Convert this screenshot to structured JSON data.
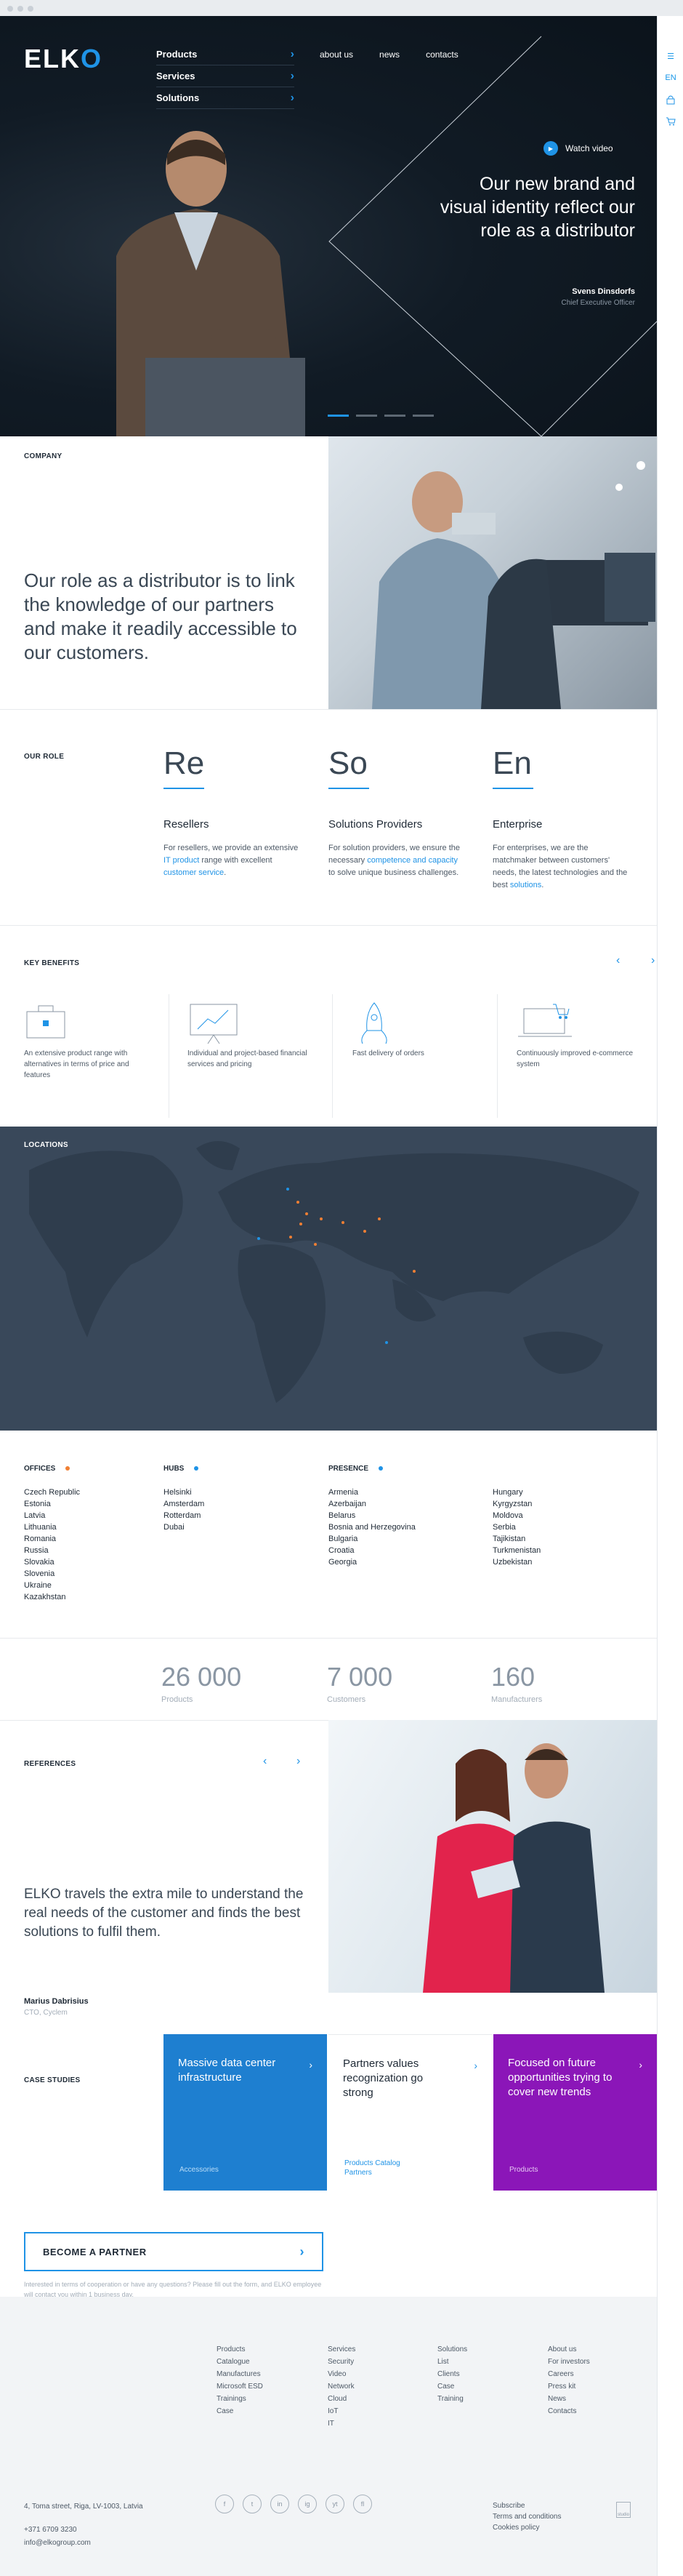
{
  "header": {
    "logo": {
      "prefix": "ELK",
      "accent": "O"
    },
    "product_menu": [
      "Products",
      "Services",
      "Solutions"
    ],
    "top_nav": [
      "about us",
      "news",
      "contacts"
    ]
  },
  "rail": {
    "menu_icon": "menu-icon",
    "lang": "EN",
    "lock_icon": "lock-icon",
    "cart_icon": "cart-icon"
  },
  "hero": {
    "watch_video": "Watch video",
    "title": "Our new brand and visual identity reflect our role as a distributor",
    "person": "Svens Dinsdorfs",
    "role": "Chief Executive Officer",
    "slides": 4,
    "active_slide": 0
  },
  "company": {
    "label": "COMPANY",
    "text": "Our role as a distributor is to link the knowledge of our partners and make it readily accessible to our customers."
  },
  "our_role": {
    "label": "OUR ROLE",
    "items": [
      {
        "abbr": "Re",
        "title": "Resellers",
        "text": [
          "For resellers, we provide an extensive ",
          "IT product",
          " range with excellent ",
          "customer service",
          "."
        ]
      },
      {
        "abbr": "So",
        "title": "Solutions Providers",
        "text": [
          "For solution providers, we ensure the necessary ",
          "competence and capacity",
          " to solve unique business challenges.",
          "",
          ""
        ]
      },
      {
        "abbr": "En",
        "title": "Enterprise",
        "text": [
          "For enterprises, we are the matchmaker between customers' needs, the latest technologies and the best ",
          "solutions",
          ".",
          "",
          ""
        ]
      }
    ]
  },
  "benefits": {
    "label": "KEY BENEFITS",
    "items": [
      "An extensive product range with alternatives in terms of price and features",
      "Individual and project-based financial services and pricing",
      "Fast delivery of orders",
      "Continuously improved e-commerce system"
    ]
  },
  "locations": {
    "label": "LOCATIONS",
    "colors": {
      "office": "#f07f33",
      "hub": "#1f93e6",
      "presence": "#1f93e6"
    }
  },
  "offices": {
    "label": "OFFICES",
    "items": [
      "Czech Republic",
      "Estonia",
      "Latvia",
      "Lithuania",
      "Romania",
      "Russia",
      "Slovakia",
      "Slovenia",
      "Ukraine",
      "Kazakhstan"
    ]
  },
  "hubs": {
    "label": "HUBS",
    "items": [
      "Helsinki",
      "Amsterdam",
      "Rotterdam",
      "Dubai"
    ]
  },
  "presence": {
    "label": "PRESENCE",
    "col1": [
      "Armenia",
      "Azerbaijan",
      "Belarus",
      "Bosnia and Herzegovina",
      "Bulgaria",
      "Croatia",
      "Georgia"
    ],
    "col2": [
      "Hungary",
      "Kyrgyzstan",
      "Moldova",
      "Serbia",
      "Tajikistan",
      "Turkmenistan",
      "Uzbekistan"
    ]
  },
  "stats": [
    {
      "value": "26 000",
      "label": "Products"
    },
    {
      "value": "7 000",
      "label": "Customers"
    },
    {
      "value": "160",
      "label": "Manufacturers"
    }
  ],
  "references": {
    "label": "REFERENCES",
    "quote": "ELKO travels the extra mile to understand the real needs of the customer and finds the best solutions to fulfil them.",
    "name": "Marius Dabrisius",
    "role": "CTO, Cyclem"
  },
  "case_studies": {
    "label": "CASE STUDIES",
    "items": [
      {
        "title": "Massive data center infrastructure",
        "tag": "Accessories",
        "bg": "#1e7fd0",
        "fg": "#ffffff"
      },
      {
        "title": "Partners values recognization go strong",
        "tag": "Products Catalog Partners",
        "bg": "#ffffff",
        "fg": "#1f2a36"
      },
      {
        "title": "Focused on future opportunities trying to cover new trends",
        "tag": "Products",
        "bg": "#8b16b8",
        "fg": "#ffffff"
      }
    ]
  },
  "partner": {
    "button": "BECOME A PARTNER",
    "note": "Interested in terms of cooperation or have any questions? Please fill out the form, and ELKO employee will contact you within 1 business day."
  },
  "footer": {
    "cols": [
      [
        "Products",
        "Catalogue",
        "Manufactures",
        "Microsoft ESD",
        "Trainings",
        "Case"
      ],
      [
        "Services",
        "Security",
        "Video",
        "Network",
        "Cloud",
        "IoT",
        "IT"
      ],
      [
        "Solutions",
        "List",
        "Clients",
        "Case",
        "Training"
      ],
      [
        "About us",
        "For investors",
        "Careers",
        "Press kit",
        "News",
        "Contacts"
      ]
    ],
    "address": "4, Toma street, Riga, LV-1003, Latvia",
    "phone": "+371 6709 3230",
    "email": "info@elkogroup.com",
    "social": [
      "f",
      "t",
      "in",
      "ig",
      "yt",
      "fl"
    ],
    "legal": [
      "Subscribe",
      "Terms and conditions",
      "Cookies policy"
    ],
    "studio": "studio"
  }
}
